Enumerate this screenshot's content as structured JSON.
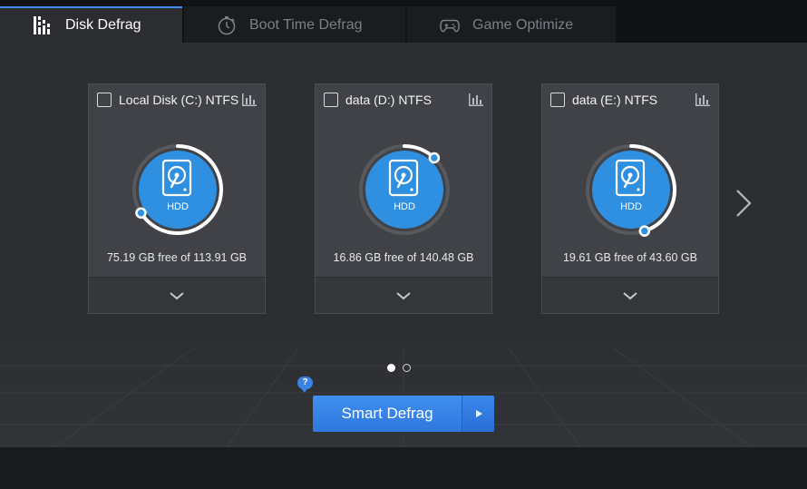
{
  "tabs": [
    {
      "label": "Disk Defrag",
      "icon": "defrag-bars-icon",
      "active": true
    },
    {
      "label": "Boot Time Defrag",
      "icon": "stopwatch-icon",
      "active": false
    },
    {
      "label": "Game Optimize",
      "icon": "gamepad-icon",
      "active": false
    }
  ],
  "disks": [
    {
      "label": "Local Disk (C:) NTFS",
      "type": "HDD",
      "free_text": "75.19 GB free of 113.91 GB",
      "free_fraction": 0.66
    },
    {
      "label": "data (D:) NTFS",
      "type": "HDD",
      "free_text": "16.86 GB free of 140.48 GB",
      "free_fraction": 0.12
    },
    {
      "label": "data (E:) NTFS",
      "type": "HDD",
      "free_text": "19.61 GB free of 43.60 GB",
      "free_fraction": 0.45
    }
  ],
  "pagination": {
    "pages": 2,
    "current": 1
  },
  "help": {
    "label": "?"
  },
  "actions": {
    "smart_defrag_label": "Smart Defrag"
  },
  "colors": {
    "accent": "#3e8df3",
    "disk_fill": "#2f8fe0",
    "ring": "#ffffff"
  }
}
